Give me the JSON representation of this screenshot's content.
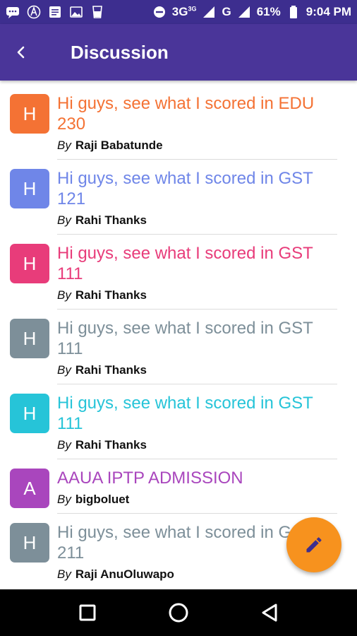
{
  "status_bar": {
    "network": "3G",
    "network_sup": "3G",
    "carrier_g": "G",
    "battery": "61%",
    "time": "9:04 PM"
  },
  "app_bar": {
    "title": "Discussion",
    "back_icon": "back-arrow-icon"
  },
  "posts": [
    {
      "initial": "H",
      "title": "Hi guys, see what I scored in EDU 230",
      "by": "By",
      "author": "Raji Babatunde",
      "color": "#f47234"
    },
    {
      "initial": "H",
      "title": "Hi guys, see what I scored in GST 121",
      "by": "By",
      "author": "Rahi Thanks",
      "color": "#6f86e8"
    },
    {
      "initial": "H",
      "title": "Hi guys, see what I scored in GST 111",
      "by": "By",
      "author": "Rahi Thanks",
      "color": "#e83c7a"
    },
    {
      "initial": "H",
      "title": "Hi guys, see what I scored in GST 111",
      "by": "By",
      "author": "Rahi Thanks",
      "color": "#7d8f99"
    },
    {
      "initial": "H",
      "title": "Hi guys, see what I scored in GST 111",
      "by": "By",
      "author": "Rahi Thanks",
      "color": "#26c4d8"
    },
    {
      "initial": "A",
      "title": "AAUA IPTP ADMISSION",
      "by": "By",
      "author": "bigboluet",
      "color": "#a946bd"
    },
    {
      "initial": "H",
      "title": "Hi guys, see what I scored in GST 211",
      "by": "By",
      "author": "Raji AnuOluwapo",
      "color": "#7d8f99"
    }
  ],
  "fab": {
    "icon": "pencil-icon",
    "color": "#f7921e"
  },
  "nav_bar": {
    "icons": [
      "square-recents-icon",
      "circle-home-icon",
      "triangle-back-icon"
    ]
  }
}
